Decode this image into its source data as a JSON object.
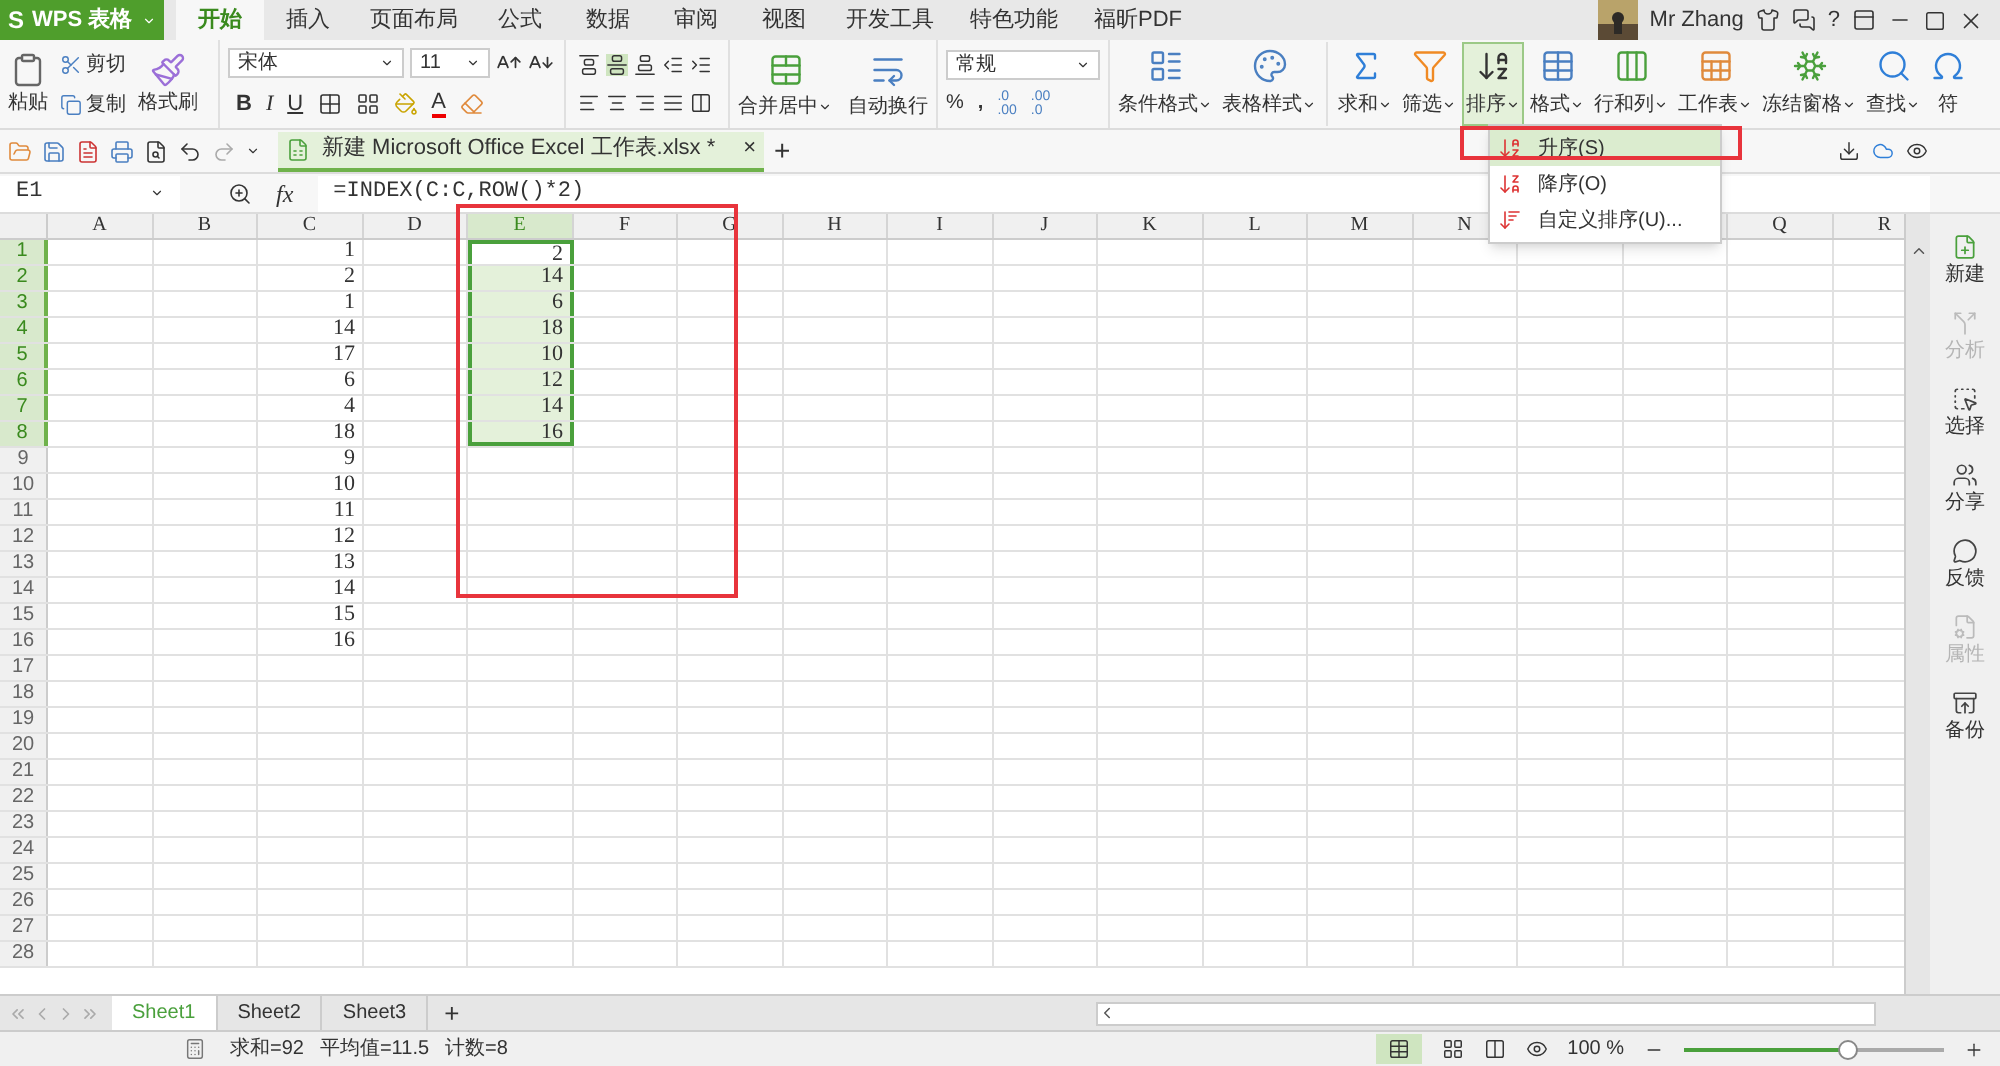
{
  "app_button": {
    "logo": "S",
    "label": "WPS 表格"
  },
  "tabs": [
    {
      "label": "开始",
      "selected": true
    },
    {
      "label": "插入",
      "selected": false
    },
    {
      "label": "页面布局",
      "selected": false
    },
    {
      "label": "公式",
      "selected": false
    },
    {
      "label": "数据",
      "selected": false
    },
    {
      "label": "审阅",
      "selected": false
    },
    {
      "label": "视图",
      "selected": false
    },
    {
      "label": "开发工具",
      "selected": false
    },
    {
      "label": "特色功能",
      "selected": false
    },
    {
      "label": "福昕PDF",
      "selected": false
    }
  ],
  "user": {
    "name": "Mr Zhang",
    "help": "?"
  },
  "ribbon": {
    "paste": "粘贴",
    "cut": "剪切",
    "copy": "复制",
    "format_painter": "格式刷",
    "font_name": "宋体",
    "font_size": "11",
    "bold": "B",
    "italic": "I",
    "underline": "U",
    "font_color": "A",
    "merge": "合并居中",
    "wrap": "自动换行",
    "number_format": "常规",
    "percent": "%",
    "comma": ",",
    "add_decimal": [
      ".0",
      ".00"
    ],
    "remove_decimal": [
      ".00",
      ".0"
    ],
    "large_buttons": [
      {
        "label": "条件格式",
        "pressed": false
      },
      {
        "label": "表格样式",
        "pressed": false
      },
      {
        "label": "求和",
        "pressed": false
      },
      {
        "label": "筛选",
        "pressed": false
      },
      {
        "label": "排序",
        "pressed": true
      },
      {
        "label": "格式",
        "pressed": false
      },
      {
        "label": "行和列",
        "pressed": false
      },
      {
        "label": "工作表",
        "pressed": false
      },
      {
        "label": "冻结窗格",
        "pressed": false
      },
      {
        "label": "查找",
        "pressed": false
      },
      {
        "label": "符",
        "pressed": false
      }
    ]
  },
  "sort_menu": [
    {
      "label": "升序(S)",
      "selected": true
    },
    {
      "label": "降序(O)",
      "selected": false
    },
    {
      "label": "自定义排序(U)...",
      "selected": false
    }
  ],
  "document_tab": {
    "title": "新建 Microsoft Office Excel 工作表.xlsx *",
    "close": "×",
    "add": "+"
  },
  "formula_bar": {
    "cell": "E1",
    "fx": "fx",
    "formula": "=INDEX(C:C,ROW()*2)"
  },
  "columns": [
    {
      "label": "A",
      "selected": false
    },
    {
      "label": "B",
      "selected": false
    },
    {
      "label": "C",
      "selected": false
    },
    {
      "label": "D",
      "selected": false
    },
    {
      "label": "E",
      "selected": true
    },
    {
      "label": "F",
      "selected": false
    },
    {
      "label": "G",
      "selected": false
    },
    {
      "label": "H",
      "selected": false
    },
    {
      "label": "I",
      "selected": false
    },
    {
      "label": "J",
      "selected": false
    },
    {
      "label": "K",
      "selected": false
    },
    {
      "label": "L",
      "selected": false
    },
    {
      "label": "M",
      "selected": false
    },
    {
      "label": "N",
      "selected": false
    }
  ],
  "columns_right": [
    {
      "label": "Q",
      "selected": false
    },
    {
      "label": "R",
      "selected": false
    }
  ],
  "rows": [
    {
      "label": "1",
      "selected": true,
      "c": "1",
      "e": "2",
      "e_active": true
    },
    {
      "label": "2",
      "selected": true,
      "c": "2",
      "e": "14",
      "e_active": false
    },
    {
      "label": "3",
      "selected": true,
      "c": "1",
      "e": "6",
      "e_active": false
    },
    {
      "label": "4",
      "selected": true,
      "c": "14",
      "e": "18",
      "e_active": false
    },
    {
      "label": "5",
      "selected": true,
      "c": "17",
      "e": "10",
      "e_active": false
    },
    {
      "label": "6",
      "selected": true,
      "c": "6",
      "e": "12",
      "e_active": false
    },
    {
      "label": "7",
      "selected": true,
      "c": "4",
      "e": "14",
      "e_active": false
    },
    {
      "label": "8",
      "selected": true,
      "c": "18",
      "e": "16",
      "e_active": false
    },
    {
      "label": "9",
      "selected": false,
      "c": "9"
    },
    {
      "label": "10",
      "selected": false,
      "c": "10"
    },
    {
      "label": "11",
      "selected": false,
      "c": "11"
    },
    {
      "label": "12",
      "selected": false,
      "c": "12"
    },
    {
      "label": "13",
      "selected": false,
      "c": "13"
    },
    {
      "label": "14",
      "selected": false,
      "c": "14"
    },
    {
      "label": "15",
      "selected": false,
      "c": "15"
    },
    {
      "label": "16",
      "selected": false,
      "c": "16"
    },
    {
      "label": "17",
      "selected": false
    },
    {
      "label": "18",
      "selected": false
    },
    {
      "label": "19",
      "selected": false
    },
    {
      "label": "20",
      "selected": false
    },
    {
      "label": "21",
      "selected": false
    },
    {
      "label": "22",
      "selected": false
    },
    {
      "label": "23",
      "selected": false
    },
    {
      "label": "24",
      "selected": false
    },
    {
      "label": "25",
      "selected": false
    },
    {
      "label": "26",
      "selected": false
    },
    {
      "label": "27",
      "selected": false
    },
    {
      "label": "28",
      "selected": false
    }
  ],
  "sidebar": [
    {
      "label": "新建",
      "disabled": false
    },
    {
      "label": "分析",
      "disabled": true
    },
    {
      "label": "选择",
      "disabled": false
    },
    {
      "label": "分享",
      "disabled": false
    },
    {
      "label": "反馈",
      "disabled": false
    },
    {
      "label": "属性",
      "disabled": true
    },
    {
      "label": "备份",
      "disabled": false
    }
  ],
  "sheets": [
    {
      "label": "Sheet1",
      "selected": true
    },
    {
      "label": "Sheet2",
      "selected": false
    },
    {
      "label": "Sheet3",
      "selected": false
    }
  ],
  "add_sheet": "+",
  "status_bar": {
    "sum": "求和=92",
    "average": "平均值=11.5",
    "count": "计数=8",
    "zoom": "100 %",
    "zoom_level": {
      "level": 0.63
    }
  }
}
